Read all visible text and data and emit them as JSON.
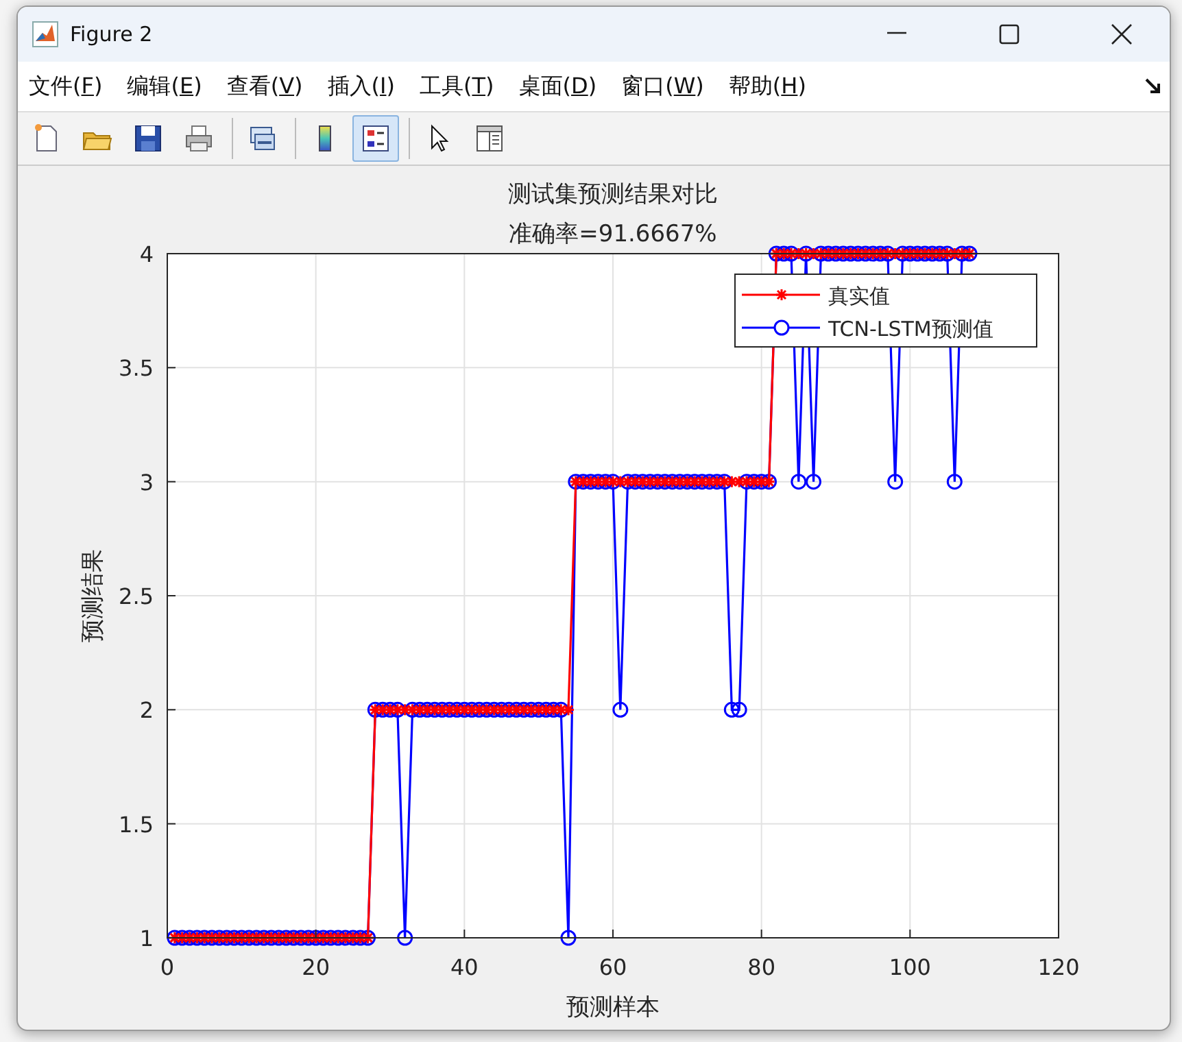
{
  "window": {
    "title": "Figure 2"
  },
  "menu": [
    {
      "label": "文件(F)"
    },
    {
      "label": "编辑(E)"
    },
    {
      "label": "查看(V)"
    },
    {
      "label": "插入(I)"
    },
    {
      "label": "工具(T)"
    },
    {
      "label": "桌面(D)"
    },
    {
      "label": "窗口(W)"
    },
    {
      "label": "帮助(H)"
    }
  ],
  "toolbar": [
    {
      "pressed": false
    },
    {
      "pressed": false
    },
    {
      "pressed": false
    },
    {
      "pressed": false
    },
    {
      "pressed": false
    },
    {
      "pressed": false
    },
    {
      "pressed": true
    },
    {
      "pressed": false
    },
    {
      "pressed": false
    }
  ],
  "figure": {
    "chart_data": {
      "type": "line",
      "title": "测试集预测结果对比",
      "subtitle": "准确率=91.6667%",
      "grid": true,
      "legend": true,
      "xlabel": "预测样本",
      "ylabel": "预测结果",
      "x": [
        1,
        2,
        3,
        4,
        5,
        6,
        7,
        8,
        9,
        10,
        11,
        12,
        13,
        14,
        15,
        16,
        17,
        18,
        19,
        20,
        21,
        22,
        23,
        24,
        25,
        26,
        27,
        28,
        29,
        30,
        31,
        32,
        33,
        34,
        35,
        36,
        37,
        38,
        39,
        40,
        41,
        42,
        43,
        44,
        45,
        46,
        47,
        48,
        49,
        50,
        51,
        52,
        53,
        54,
        55,
        56,
        57,
        58,
        59,
        60,
        61,
        62,
        63,
        64,
        65,
        66,
        67,
        68,
        69,
        70,
        71,
        72,
        73,
        74,
        75,
        76,
        77,
        78,
        79,
        80,
        81,
        82,
        83,
        84,
        85,
        86,
        87,
        88,
        89,
        90,
        91,
        92,
        93,
        94,
        95,
        96,
        97,
        98,
        99,
        100,
        101,
        102,
        103,
        104,
        105,
        106,
        107,
        108
      ],
      "series": [
        {
          "name": "真实值",
          "color": "#ff0000",
          "marker": "cross",
          "values": [
            1,
            1,
            1,
            1,
            1,
            1,
            1,
            1,
            1,
            1,
            1,
            1,
            1,
            1,
            1,
            1,
            1,
            1,
            1,
            1,
            1,
            1,
            1,
            1,
            1,
            1,
            1,
            2,
            2,
            2,
            2,
            2,
            2,
            2,
            2,
            2,
            2,
            2,
            2,
            2,
            2,
            2,
            2,
            2,
            2,
            2,
            2,
            2,
            2,
            2,
            2,
            2,
            2,
            2,
            3,
            3,
            3,
            3,
            3,
            3,
            3,
            3,
            3,
            3,
            3,
            3,
            3,
            3,
            3,
            3,
            3,
            3,
            3,
            3,
            3,
            3,
            3,
            3,
            3,
            3,
            3,
            4,
            4,
            4,
            4,
            4,
            4,
            4,
            4,
            4,
            4,
            4,
            4,
            4,
            4,
            4,
            4,
            4,
            4,
            4,
            4,
            4,
            4,
            4,
            4,
            4,
            4,
            4
          ]
        },
        {
          "name": "TCN-LSTM预测值",
          "color": "#0000ff",
          "marker": "circle",
          "values": [
            1,
            1,
            1,
            1,
            1,
            1,
            1,
            1,
            1,
            1,
            1,
            1,
            1,
            1,
            1,
            1,
            1,
            1,
            1,
            1,
            1,
            1,
            1,
            1,
            1,
            1,
            1,
            2,
            2,
            2,
            2,
            1,
            2,
            2,
            2,
            2,
            2,
            2,
            2,
            2,
            2,
            2,
            2,
            2,
            2,
            2,
            2,
            2,
            2,
            2,
            2,
            2,
            2,
            1,
            3,
            3,
            3,
            3,
            3,
            3,
            2,
            3,
            3,
            3,
            3,
            3,
            3,
            3,
            3,
            3,
            3,
            3,
            3,
            3,
            3,
            2,
            2,
            3,
            3,
            3,
            3,
            4,
            4,
            4,
            3,
            4,
            3,
            4,
            4,
            4,
            4,
            4,
            4,
            4,
            4,
            4,
            4,
            3,
            4,
            4,
            4,
            4,
            4,
            4,
            4,
            3,
            4,
            4
          ]
        }
      ],
      "xlim": [
        0,
        120
      ],
      "ylim": [
        1,
        4
      ],
      "xticks": [
        0,
        20,
        40,
        60,
        80,
        100,
        120
      ],
      "yticks": [
        1,
        1.5,
        2,
        2.5,
        3,
        3.5,
        4
      ]
    }
  }
}
